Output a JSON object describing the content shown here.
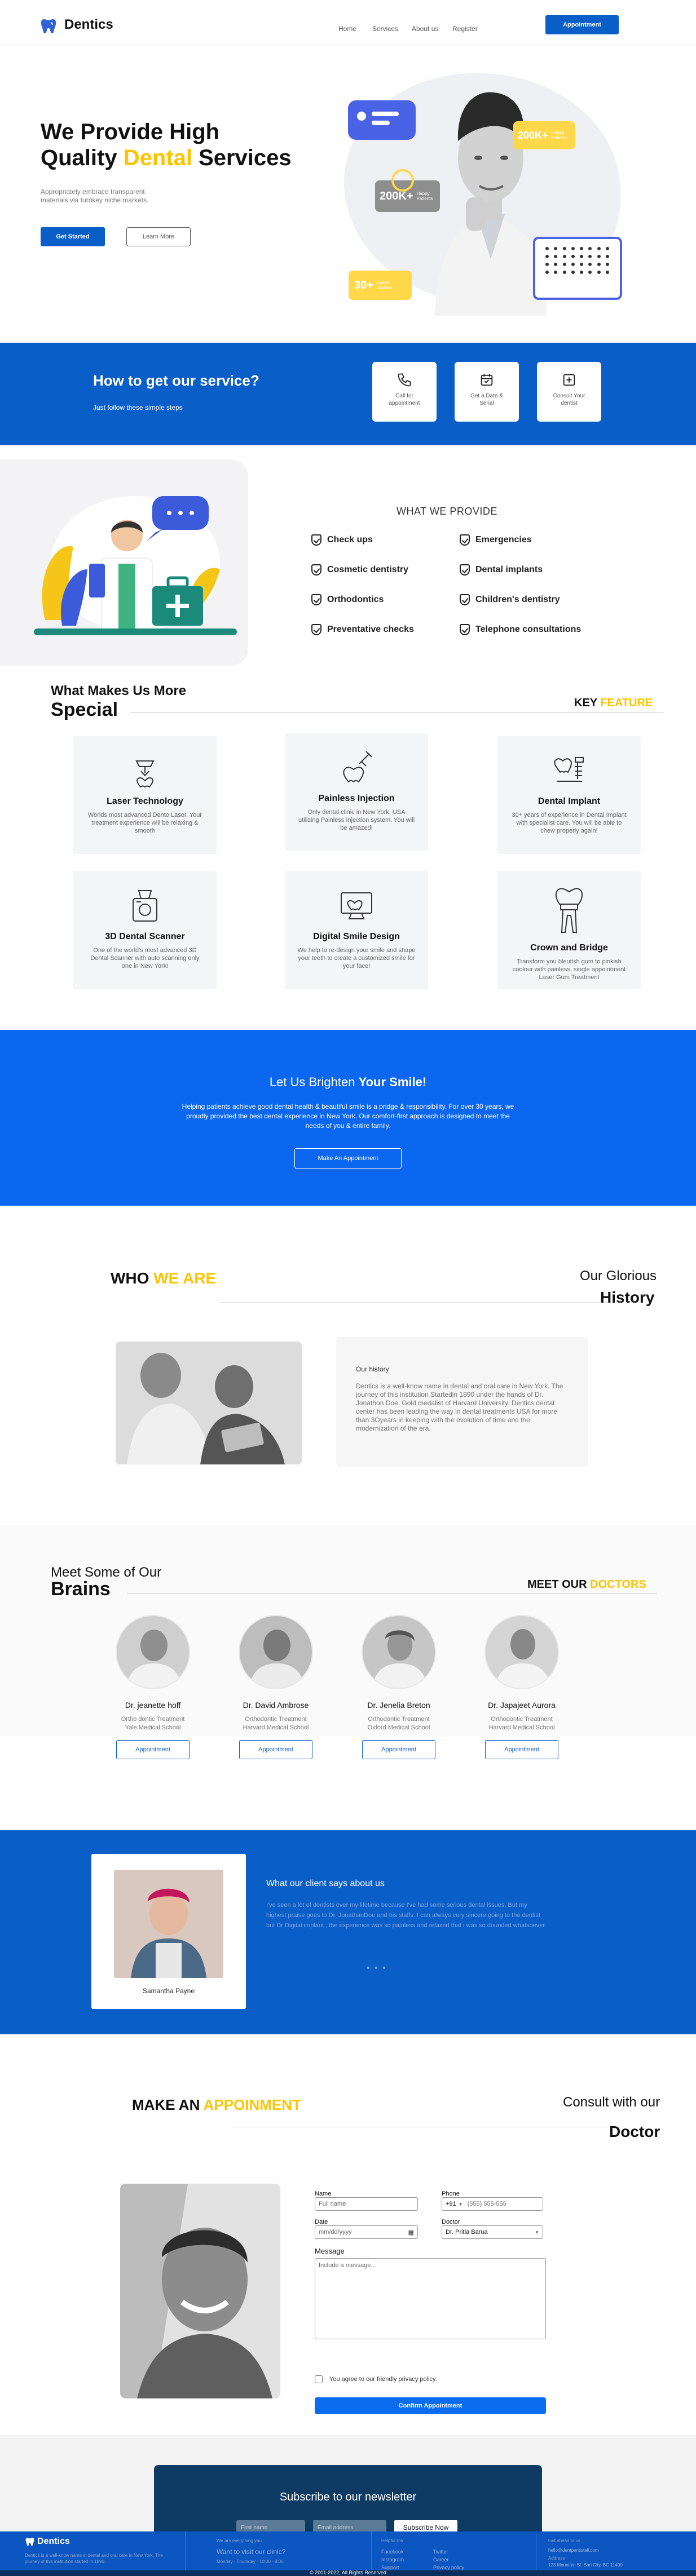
{
  "nav": {
    "brand": "Dentics",
    "links": [
      "Home",
      "Services",
      "About us",
      "Register"
    ],
    "cta": "Appointment"
  },
  "hero": {
    "title_1": "We Provide High",
    "title_2a": "Quality ",
    "title_2b": "Dental",
    "title_2c": " Services",
    "subtitle": "Appropriately embrace transparent materials via turnkey niche markets.",
    "get_started": "Get Started",
    "learn_more": "Learn More",
    "stat_1_num": "200K+",
    "stat_1_label": "Happy Patients",
    "stat_2_num": "200K+",
    "stat_2_label": "Happy Patients",
    "stat_3_num": "30+",
    "stat_3_label": "Expert Doctors"
  },
  "how": {
    "title": "How to get our service?",
    "subtitle": "Just follow these simple steps",
    "steps": [
      {
        "label": "Call for appointment"
      },
      {
        "label": "Get a Date & Serial"
      },
      {
        "label": "Consult Your dentist"
      }
    ]
  },
  "provide": {
    "heading": "WHAT WE PROVIDE",
    "services": [
      "Check ups",
      "Emergencies",
      "Cosmetic dentistry",
      "Dental implants",
      "Orthodontics",
      "Children's dentistry",
      "Preventative checks",
      "Telephone consultations"
    ]
  },
  "makes": {
    "line1": "What Makes Us More",
    "line2": "Special",
    "key": "KEY ",
    "feature": "FEATURE",
    "features": [
      {
        "title": "Laser Technology",
        "desc": "Worlds most advanced Dento Laser. Your treatment experience will be relaxing & smooth"
      },
      {
        "title": "Painless Injection",
        "desc": "Only dental clinic in New York, USA utilizing Painless Injection system. You will be amazed!"
      },
      {
        "title": "Dental Implant",
        "desc": "30+ years of experience in Dental Implant with specialist care. You will be able to chew properly again!"
      },
      {
        "title": "3D Dental Scanner",
        "desc": "One of the world's most advanced 3D Dental Scanner with auto scanning only one in New York!"
      },
      {
        "title": "Digital Smile Design",
        "desc": "We help to re-design your smile and shape your teeth to create a customized smile for your face!"
      },
      {
        "title": "Crown and Bridge",
        "desc": "Transform you bleutish gum to pinkish coolour with painless, single appointment Laser Gum Treatment"
      }
    ]
  },
  "brighten": {
    "title_a": "Let Us Brighten ",
    "title_b": "Your Smile!",
    "body": "Helping patients achieve good dental health & beautiful smile is a pridge & responsibility. For over 30 years, we proudly provided the best dental experience in New York. Our comfort-first approach is designed to meet the needs of you & entire family.",
    "button": "Make An Appointment"
  },
  "who": {
    "who": "WHO ",
    "we_are": "WE ARE",
    "glorious": "Our Glorious",
    "history": "History",
    "card_title": "Our history",
    "card_body": "Dentics is a well-know name in dental and oral care in New York. The journey of this institution Startedin 1890 under the hands of Dr. Jonathon Doe. Gold medalist of Harvard University. Dentics dental center has been leading the way in dental treatments USA for more than 3Oyears in keeping with the evolution of time and the modernization of the era."
  },
  "brains": {
    "line1": "Meet Some of Our",
    "line2": "Brains",
    "meet_our": "MEET OUR ",
    "doctors": "DOCTORS",
    "list": [
      {
        "name": "Dr. jeanette hoff",
        "role": "Ortho dontic Treatment Yale Medical School",
        "btn": "Appointment"
      },
      {
        "name": "Dr. David Ambrose",
        "role": "Orthodontic Treatment Harvard Medical School",
        "btn": "Appointment"
      },
      {
        "name": "Dr. Jenelia Breton",
        "role": "Orthodontic Treatment Oxford Medical School",
        "btn": "Appointment"
      },
      {
        "name": "Dr. Japajeet Aurora",
        "role": "Orthodontic Treatment Harvard Medical School",
        "btn": "Appointment"
      }
    ]
  },
  "testimonial": {
    "name": "Samantha Payne",
    "title": "What our client says about us",
    "body": "I've seen a lot of dentists over my lifetime because I've had some serious dental issues. But my highest praise goes to Dr. JonathanDoe and his staffs. I can always very sincere going to the dentist but Dr Digital implant , the experience was so painless and relaxed that i was so dounded whatsoever.",
    "dots": "• • •"
  },
  "appoint": {
    "make_an": "MAKE AN ",
    "appoinment": "APPOINMENT",
    "consult": "Consult with our",
    "doctor": "Doctor",
    "name_label": "Name",
    "name_ph": "Full name",
    "phone_label": "Phone",
    "phone_code": "+91",
    "phone_ph": "(555) 555-555",
    "date_label": "Date",
    "date_ph": "mm/dd/yyyy",
    "doctor_label": "Doctor",
    "doctor_value": "Dr. Pritla Barua",
    "message_label": "Message",
    "message_ph": "Include a message...",
    "agree": "You agree to our friendly privacy policy.",
    "confirm": "Confirm Appointment"
  },
  "newsletter": {
    "title": "Subscribe to our newsletter",
    "first_ph": "First name",
    "email_ph": "Email address",
    "button": "Subscribe Now"
  },
  "footer": {
    "brand": "Dentics",
    "about": "Dentics is a well-know name in dental and oral care in New York. The journey of this institution started in 1890.",
    "col2_head": "We are everything you",
    "col2_title": "Want to visit our clinic?",
    "col2_a": "Monday - Thursday",
    "col2_b": "10:00 - 8:00",
    "col3_head": "Helpful link",
    "links_a": [
      "Facebook",
      "Instagram",
      "Support"
    ],
    "links_b": [
      "Twitter",
      "Career",
      "Privacy policy"
    ],
    "col4_head": "Get ahead to us",
    "email": "hello@dentpentistall.com",
    "addr_label": "Address",
    "addr": "123 Mountain St. San City, BC 11400",
    "copyright": "© 2001-2022, All Rights Reserved"
  }
}
